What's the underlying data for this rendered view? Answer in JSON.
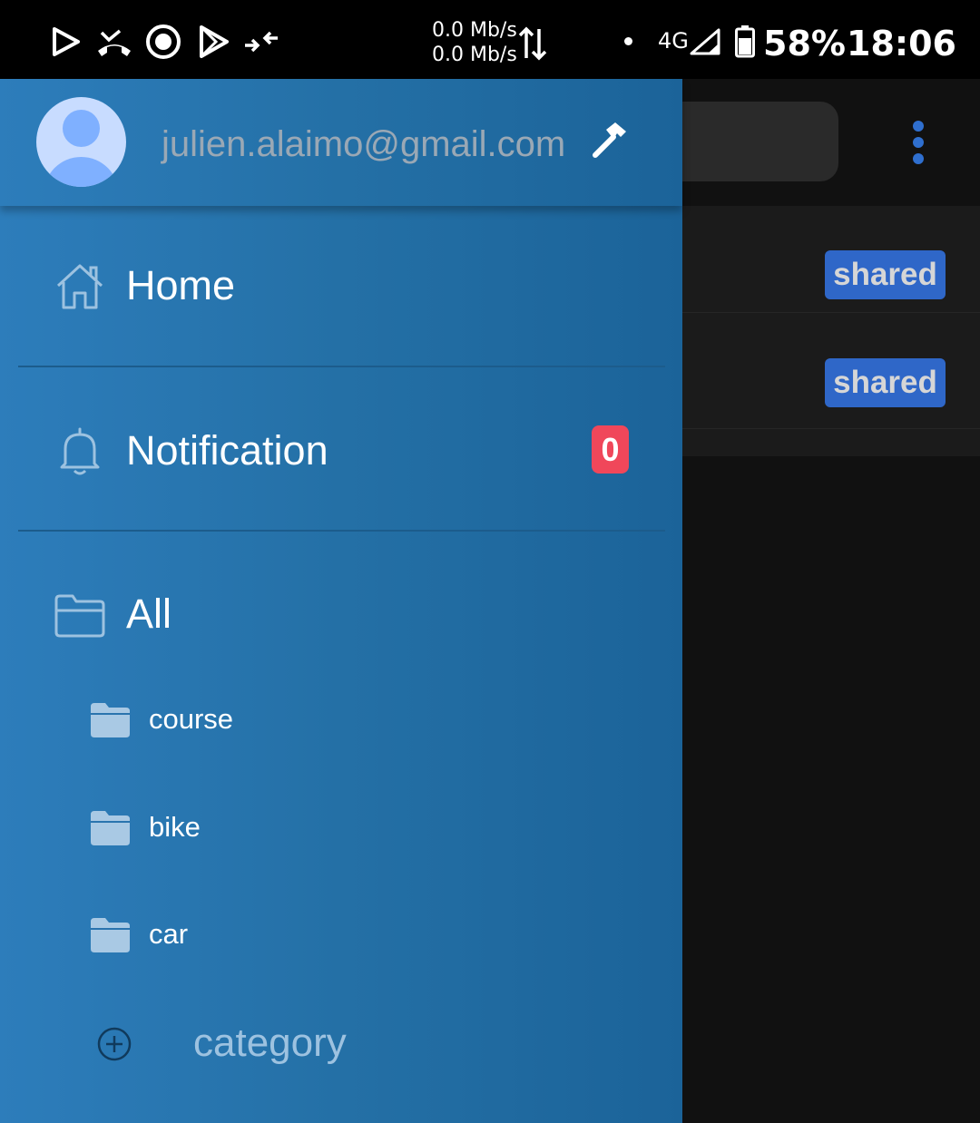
{
  "status_bar": {
    "net_speed_up": "0.0 Mb/s",
    "net_speed_down": "0.0 Mb/s",
    "network_type": "4G",
    "battery": "58%",
    "time": "18:06",
    "icons": [
      "play-store-icon",
      "missed-call-icon",
      "sync-icon",
      "play-icon",
      "data-compress-icon"
    ]
  },
  "drawer": {
    "email": "julien.alaimo@gmail.com",
    "items": [
      {
        "label": "Home",
        "icon": "home-icon"
      },
      {
        "label": "Notification",
        "icon": "bell-icon",
        "badge": "0"
      },
      {
        "label": "All",
        "icon": "folder-open-icon"
      }
    ],
    "categories": [
      {
        "label": "course",
        "icon": "folder-icon"
      },
      {
        "label": "bike",
        "icon": "folder-icon"
      },
      {
        "label": "car",
        "icon": "folder-icon"
      }
    ],
    "add_category_label": "category"
  },
  "background": {
    "rows": [
      {
        "badge": "shared"
      },
      {
        "badge": "shared"
      }
    ]
  },
  "colors": {
    "drawer_gradient": [
      "#2d7dbb",
      "#1b6399"
    ],
    "badge_red": "#f0475a",
    "shared_blue": "#2f67c8",
    "accent_blue": "#2f6fcf"
  }
}
